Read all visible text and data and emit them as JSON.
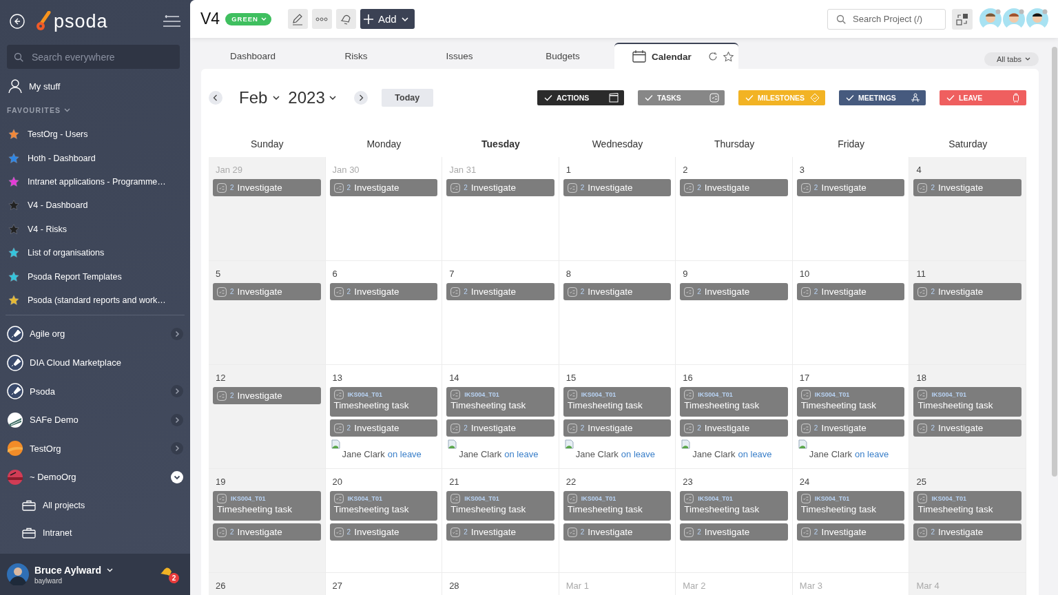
{
  "sidebar": {
    "brand": "psoda",
    "search": {
      "placeholder": "Search everywhere"
    },
    "my_stuff": "My stuff",
    "favourites_label": "FAVOURITES",
    "favourites": [
      {
        "label": "TestOrg - Users",
        "color": "#f0883a"
      },
      {
        "label": "Hoth - Dashboard",
        "color": "#2f86e4"
      },
      {
        "label": "Intranet applications - Programme…",
        "color": "#e43bd6"
      },
      {
        "label": "V4 - Dashboard",
        "color": "#222222"
      },
      {
        "label": "V4 - Risks",
        "color": "#222222"
      },
      {
        "label": "List of organisations",
        "color": "#35c4dc"
      },
      {
        "label": "Psoda Report Templates",
        "color": "#35c4dc"
      },
      {
        "label": "Psoda (standard reports and work…",
        "color": "#e5b935"
      }
    ],
    "orgs": [
      {
        "name": "Agile org",
        "kind": "rocket",
        "has_children": true,
        "expanded": false
      },
      {
        "name": "DIA Cloud Marketplace",
        "kind": "rocket",
        "has_children": false,
        "expanded": false
      },
      {
        "name": "Psoda",
        "kind": "rocket",
        "has_children": true,
        "expanded": false
      },
      {
        "name": "SAFe Demo",
        "kind": "stripes",
        "has_children": true,
        "expanded": false
      },
      {
        "name": "TestOrg",
        "kind": "sun",
        "has_children": true,
        "expanded": false
      },
      {
        "name": "~ DemoOrg",
        "kind": "sunset",
        "has_children": true,
        "expanded": true
      }
    ],
    "sub_items": [
      "All projects",
      "Intranet"
    ],
    "user": {
      "name": "Bruce Aylward",
      "username": "baylward",
      "notifications": "2"
    }
  },
  "header": {
    "title": "V4",
    "status": {
      "label": "GREEN",
      "color": "#3fbf5f"
    },
    "add_label": "Add",
    "search": {
      "placeholder": "Search Project (/)"
    }
  },
  "tabs": [
    {
      "label": "Dashboard",
      "selected": false
    },
    {
      "label": "Risks",
      "selected": false
    },
    {
      "label": "Issues",
      "selected": false
    },
    {
      "label": "Budgets",
      "selected": false
    },
    {
      "label": "Calendar",
      "selected": true
    }
  ],
  "all_tabs": "All tabs",
  "calendar": {
    "month": "Feb",
    "year": "2023",
    "today_label": "Today",
    "filters": [
      {
        "label": "ACTIONS",
        "kind": "actions",
        "color": "#2b2b2b",
        "checked": true
      },
      {
        "label": "TASKS",
        "kind": "tasks",
        "color": "#878787",
        "checked": true
      },
      {
        "label": "MILESTONES",
        "kind": "milestones",
        "color": "#f2b324",
        "checked": true
      },
      {
        "label": "MEETINGS",
        "kind": "meetings",
        "color": "#465a7e",
        "checked": true
      },
      {
        "label": "LEAVE",
        "kind": "leave",
        "color": "#ef5f5f",
        "checked": true
      }
    ],
    "day_headers": [
      {
        "label": "Sunday",
        "current": false
      },
      {
        "label": "Monday",
        "current": false
      },
      {
        "label": "Tuesday",
        "current": true
      },
      {
        "label": "Wednesday",
        "current": false
      },
      {
        "label": "Thursday",
        "current": false
      },
      {
        "label": "Friday",
        "current": false
      },
      {
        "label": "Saturday",
        "current": false
      }
    ],
    "weeks": [
      {
        "days": [
          {
            "date": "Jan 29",
            "outside_month": true,
            "events": [
              {
                "kind": "investigate",
                "count": "2",
                "title": "Investigate"
              }
            ]
          },
          {
            "date": "Jan 30",
            "outside_month": true,
            "events": [
              {
                "kind": "investigate",
                "count": "2",
                "title": "Investigate"
              }
            ]
          },
          {
            "date": "Jan 31",
            "outside_month": true,
            "events": [
              {
                "kind": "investigate",
                "count": "2",
                "title": "Investigate"
              }
            ]
          },
          {
            "date": "1",
            "outside_month": false,
            "events": [
              {
                "kind": "investigate",
                "count": "2",
                "title": "Investigate"
              }
            ]
          },
          {
            "date": "2",
            "outside_month": false,
            "events": [
              {
                "kind": "investigate",
                "count": "2",
                "title": "Investigate"
              }
            ]
          },
          {
            "date": "3",
            "outside_month": false,
            "events": [
              {
                "kind": "investigate",
                "count": "2",
                "title": "Investigate"
              }
            ]
          },
          {
            "date": "4",
            "outside_month": false,
            "events": [
              {
                "kind": "investigate",
                "count": "2",
                "title": "Investigate"
              }
            ]
          }
        ]
      },
      {
        "days": [
          {
            "date": "5",
            "outside_month": false,
            "events": [
              {
                "kind": "investigate",
                "count": "2",
                "title": "Investigate"
              }
            ]
          },
          {
            "date": "6",
            "outside_month": false,
            "events": [
              {
                "kind": "investigate",
                "count": "2",
                "title": "Investigate"
              }
            ]
          },
          {
            "date": "7",
            "outside_month": false,
            "events": [
              {
                "kind": "investigate",
                "count": "2",
                "title": "Investigate"
              }
            ]
          },
          {
            "date": "8",
            "outside_month": false,
            "events": [
              {
                "kind": "investigate",
                "count": "2",
                "title": "Investigate"
              }
            ]
          },
          {
            "date": "9",
            "outside_month": false,
            "events": [
              {
                "kind": "investigate",
                "count": "2",
                "title": "Investigate"
              }
            ]
          },
          {
            "date": "10",
            "outside_month": false,
            "events": [
              {
                "kind": "investigate",
                "count": "2",
                "title": "Investigate"
              }
            ]
          },
          {
            "date": "11",
            "outside_month": false,
            "events": [
              {
                "kind": "investigate",
                "count": "2",
                "title": "Investigate"
              }
            ]
          }
        ]
      },
      {
        "days": [
          {
            "date": "12",
            "outside_month": false,
            "events": [
              {
                "kind": "investigate",
                "count": "2",
                "title": "Investigate"
              }
            ]
          },
          {
            "date": "13",
            "outside_month": false,
            "events": [
              {
                "kind": "task",
                "code": "IKS004_T01",
                "title": "Timesheeting task"
              },
              {
                "kind": "investigate",
                "count": "2",
                "title": "Investigate"
              },
              {
                "kind": "leave",
                "name": "Jane Clark",
                "link": "on leave"
              }
            ]
          },
          {
            "date": "14",
            "outside_month": false,
            "events": [
              {
                "kind": "task",
                "code": "IKS004_T01",
                "title": "Timesheeting task"
              },
              {
                "kind": "investigate",
                "count": "2",
                "title": "Investigate"
              },
              {
                "kind": "leave",
                "name": "Jane Clark",
                "link": "on leave"
              }
            ]
          },
          {
            "date": "15",
            "outside_month": false,
            "events": [
              {
                "kind": "task",
                "code": "IKS004_T01",
                "title": "Timesheeting task"
              },
              {
                "kind": "investigate",
                "count": "2",
                "title": "Investigate"
              },
              {
                "kind": "leave",
                "name": "Jane Clark",
                "link": "on leave"
              }
            ]
          },
          {
            "date": "16",
            "outside_month": false,
            "events": [
              {
                "kind": "task",
                "code": "IKS004_T01",
                "title": "Timesheeting task"
              },
              {
                "kind": "investigate",
                "count": "2",
                "title": "Investigate"
              },
              {
                "kind": "leave",
                "name": "Jane Clark",
                "link": "on leave"
              }
            ]
          },
          {
            "date": "17",
            "outside_month": false,
            "events": [
              {
                "kind": "task",
                "code": "IKS004_T01",
                "title": "Timesheeting task"
              },
              {
                "kind": "investigate",
                "count": "2",
                "title": "Investigate"
              },
              {
                "kind": "leave",
                "name": "Jane Clark",
                "link": "on leave"
              }
            ]
          },
          {
            "date": "18",
            "outside_month": false,
            "events": [
              {
                "kind": "task",
                "code": "IKS004_T01",
                "title": "Timesheeting task"
              },
              {
                "kind": "investigate",
                "count": "2",
                "title": "Investigate"
              }
            ]
          }
        ]
      },
      {
        "days": [
          {
            "date": "19",
            "outside_month": false,
            "events": [
              {
                "kind": "task",
                "code": "IKS004_T01",
                "title": "Timesheeting task"
              },
              {
                "kind": "investigate",
                "count": "2",
                "title": "Investigate"
              }
            ]
          },
          {
            "date": "20",
            "outside_month": false,
            "events": [
              {
                "kind": "task",
                "code": "IKS004_T01",
                "title": "Timesheeting task"
              },
              {
                "kind": "investigate",
                "count": "2",
                "title": "Investigate"
              }
            ]
          },
          {
            "date": "21",
            "outside_month": false,
            "events": [
              {
                "kind": "task",
                "code": "IKS004_T01",
                "title": "Timesheeting task"
              },
              {
                "kind": "investigate",
                "count": "2",
                "title": "Investigate"
              }
            ]
          },
          {
            "date": "22",
            "outside_month": false,
            "events": [
              {
                "kind": "task",
                "code": "IKS004_T01",
                "title": "Timesheeting task"
              },
              {
                "kind": "investigate",
                "count": "2",
                "title": "Investigate"
              }
            ]
          },
          {
            "date": "23",
            "outside_month": false,
            "events": [
              {
                "kind": "task",
                "code": "IKS004_T01",
                "title": "Timesheeting task"
              },
              {
                "kind": "investigate",
                "count": "2",
                "title": "Investigate"
              }
            ]
          },
          {
            "date": "24",
            "outside_month": false,
            "events": [
              {
                "kind": "task",
                "code": "IKS004_T01",
                "title": "Timesheeting task"
              },
              {
                "kind": "investigate",
                "count": "2",
                "title": "Investigate"
              }
            ]
          },
          {
            "date": "25",
            "outside_month": false,
            "events": [
              {
                "kind": "task",
                "code": "IKS004_T01",
                "title": "Timesheeting task"
              },
              {
                "kind": "investigate",
                "count": "2",
                "title": "Investigate"
              }
            ]
          }
        ]
      },
      {
        "days": [
          {
            "date": "26",
            "outside_month": false
          },
          {
            "date": "27",
            "outside_month": false
          },
          {
            "date": "28",
            "outside_month": false
          },
          {
            "date": "Mar 1",
            "outside_month": true
          },
          {
            "date": "Mar 2",
            "outside_month": true
          },
          {
            "date": "Mar 3",
            "outside_month": true
          },
          {
            "date": "Mar 4",
            "outside_month": true
          }
        ]
      }
    ]
  }
}
